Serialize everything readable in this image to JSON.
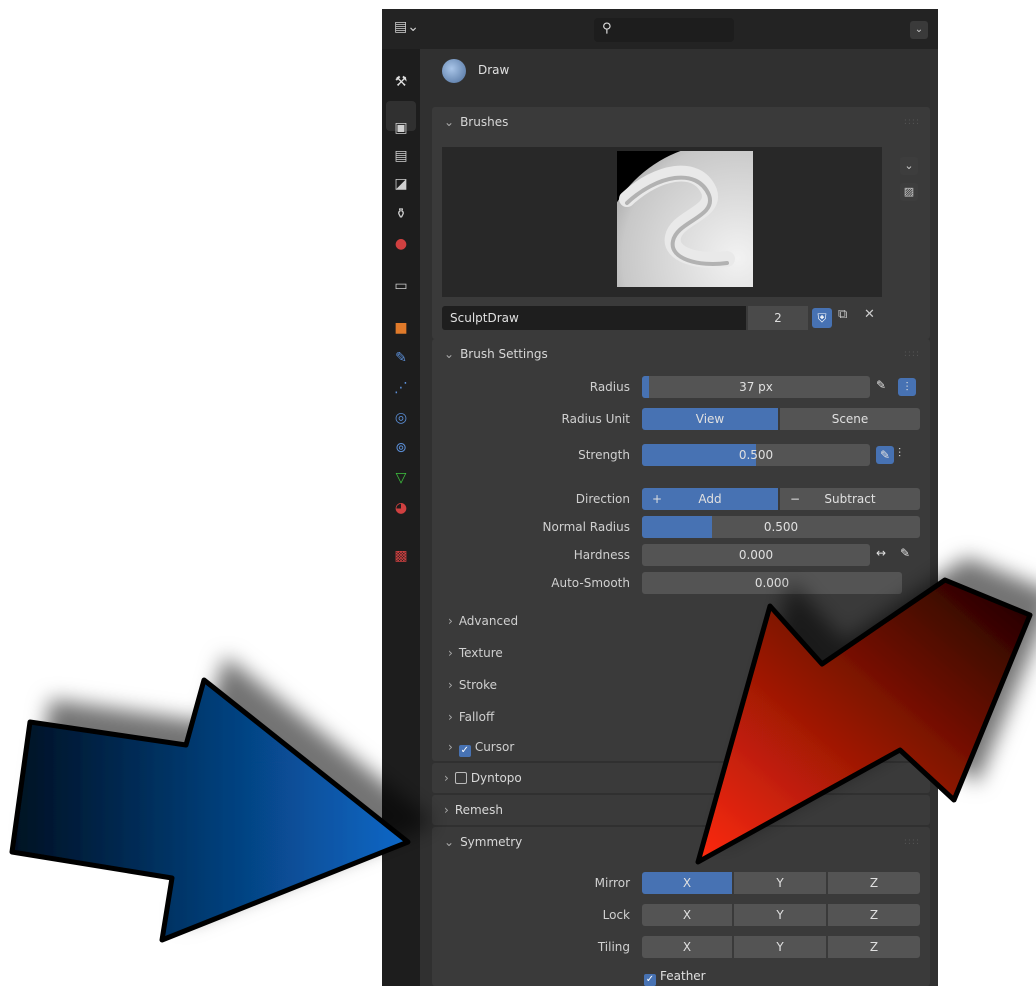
{
  "window": {
    "search": {
      "placeholder": "",
      "value": ""
    },
    "active_tool": "Draw"
  },
  "sidebar_tabs": [
    {
      "name": "tool",
      "glyph": "⚒",
      "color": "#e0e0e0"
    },
    {
      "name": "render",
      "glyph": "▣",
      "color": "#cfcfcf"
    },
    {
      "name": "output",
      "glyph": "▤",
      "color": "#cfcfcf"
    },
    {
      "name": "view-layer",
      "glyph": "◪",
      "color": "#cfcfcf"
    },
    {
      "name": "scene",
      "glyph": "⚱",
      "color": "#cfcfcf"
    },
    {
      "name": "world",
      "glyph": "●",
      "color": "#d04040"
    },
    {
      "name": "collection",
      "glyph": "▭",
      "color": "#cfcfcf"
    },
    {
      "name": "object",
      "glyph": "■",
      "color": "#e07a2a"
    },
    {
      "name": "modifier",
      "glyph": "✎",
      "color": "#5b8fd8"
    },
    {
      "name": "particles",
      "glyph": "⋰",
      "color": "#5b8fd8"
    },
    {
      "name": "physics",
      "glyph": "◎",
      "color": "#5b8fd8"
    },
    {
      "name": "constraints",
      "glyph": "⊚",
      "color": "#5b8fd8"
    },
    {
      "name": "data",
      "glyph": "▽",
      "color": "#3ec23e"
    },
    {
      "name": "material",
      "glyph": "◕",
      "color": "#d04040"
    },
    {
      "name": "texture",
      "glyph": "▩",
      "color": "#d04040"
    }
  ],
  "brushes": {
    "header": "Brushes",
    "brush_name": "SculptDraw",
    "users": "2"
  },
  "brush_settings": {
    "header": "Brush Settings",
    "radius": {
      "label": "Radius",
      "value": "37 px",
      "fill": 0.03
    },
    "radius_unit": {
      "label": "Radius Unit",
      "options": [
        "View",
        "Scene"
      ],
      "selected": "View"
    },
    "strength": {
      "label": "Strength",
      "value": "0.500",
      "fill": 0.5
    },
    "direction": {
      "label": "Direction",
      "options": [
        "Add",
        "Subtract"
      ],
      "selected": "Add"
    },
    "normal_radius": {
      "label": "Normal Radius",
      "value": "0.500",
      "fill": 0.25
    },
    "hardness": {
      "label": "Hardness",
      "value": "0.000",
      "fill": 0
    },
    "auto_smooth": {
      "label": "Auto-Smooth",
      "value": "0.000",
      "fill": 0
    },
    "subpanels": [
      "Advanced",
      "Texture",
      "Stroke",
      "Falloff"
    ],
    "cursor": {
      "label": "Cursor",
      "checked": true
    }
  },
  "dyntopo": {
    "label": "Dyntopo",
    "checked": false
  },
  "remesh": {
    "label": "Remesh"
  },
  "symmetry": {
    "header": "Symmetry",
    "mirror": {
      "label": "Mirror",
      "axes": [
        "X",
        "Y",
        "Z"
      ],
      "active": [
        "X"
      ]
    },
    "lock": {
      "label": "Lock",
      "axes": [
        "X",
        "Y",
        "Z"
      ]
    },
    "tiling": {
      "label": "Tiling",
      "axes": [
        "X",
        "Y",
        "Z"
      ]
    },
    "feather": {
      "label": "Feather",
      "checked": true
    }
  },
  "colors": {
    "accent": "#4772b3",
    "blue_arrow": "#0a5fb4",
    "red_arrow": "#e02a10"
  }
}
